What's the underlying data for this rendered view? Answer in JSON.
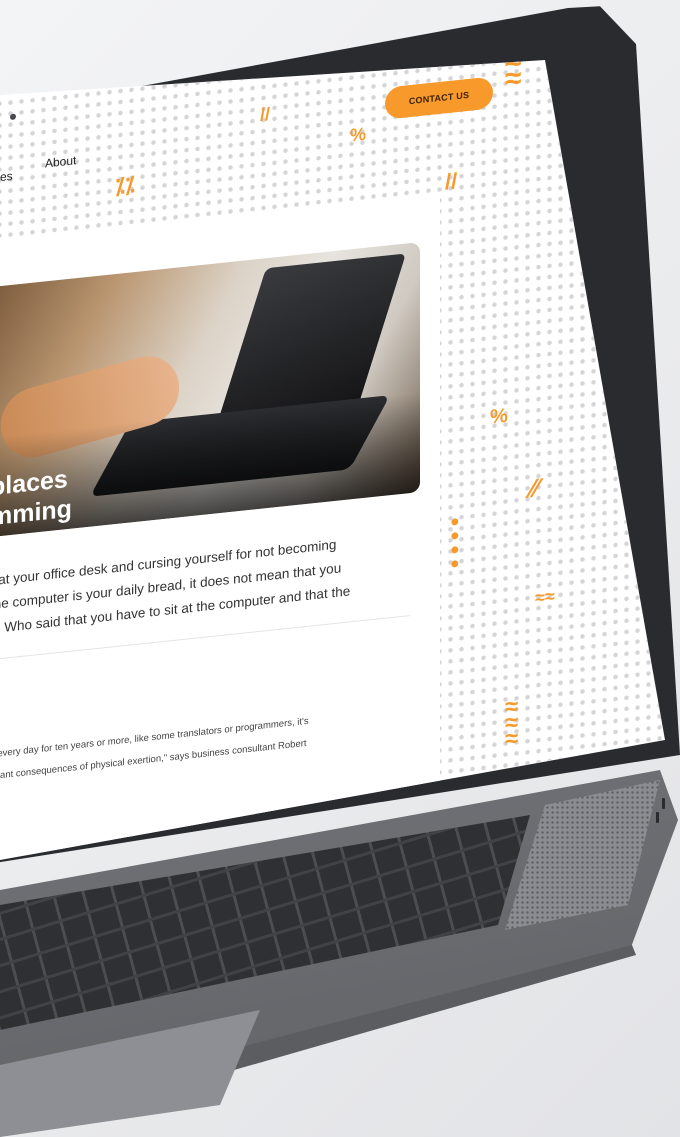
{
  "nav": {
    "items": [
      "es",
      "About"
    ],
    "contact_label": "CONTACT US"
  },
  "article": {
    "title_lines": [
      "places",
      "mming"
    ],
    "body_lines": [
      "r at your office desk and cursing yourself  for not becoming",
      "the computer is your daily bread, it does not mean that you",
      "k. Who said that you have to sit at the computer and that the"
    ],
    "quote_lines": [
      "y every day for ten years or more, like some translators or programmers, it's",
      "asant consequences of physical exertion,\" says business consultant Robert"
    ]
  },
  "colors": {
    "accent": "#f79a2b",
    "bezel": "#2a2b2e",
    "body": "#76787d"
  },
  "icons": {
    "decor": "orange-wave-pattern",
    "camera": "camera-dot"
  }
}
